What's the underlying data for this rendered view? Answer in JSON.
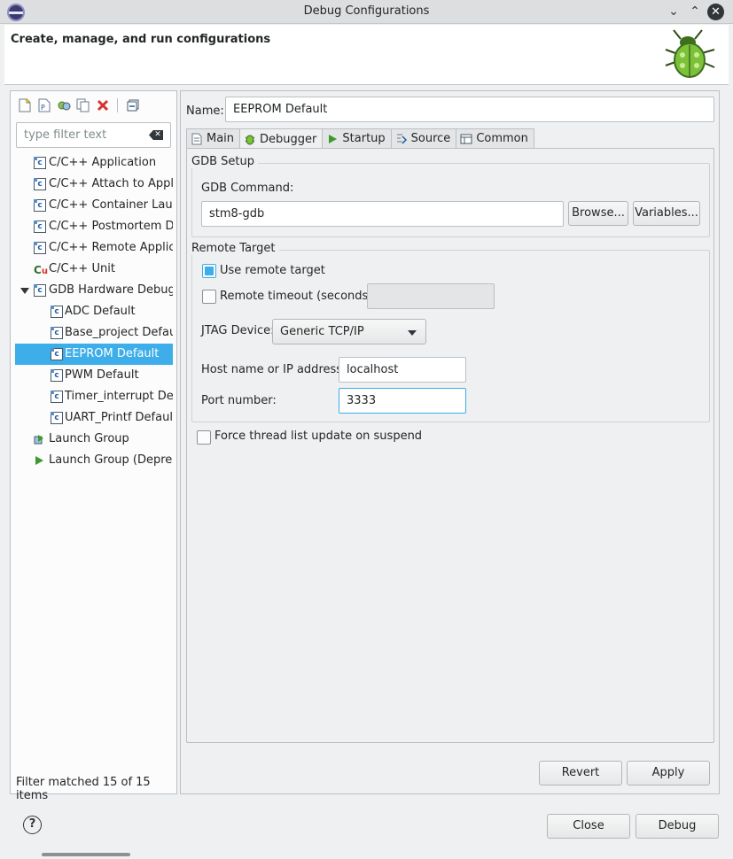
{
  "window": {
    "title": "Debug Configurations"
  },
  "header": {
    "heading": "Create, manage, and run configurations"
  },
  "left": {
    "filter_placeholder": "type filter text",
    "items": [
      {
        "label": "C/C++ Application"
      },
      {
        "label": "C/C++ Attach to Application"
      },
      {
        "label": "C/C++ Container Launcher"
      },
      {
        "label": "C/C++ Postmortem Debugger"
      },
      {
        "label": "C/C++ Remote Application"
      },
      {
        "label": "C/C++ Unit"
      },
      {
        "label": "GDB Hardware Debugging"
      },
      {
        "label": "ADC Default"
      },
      {
        "label": "Base_project Default"
      },
      {
        "label": "EEPROM Default"
      },
      {
        "label": "PWM Default"
      },
      {
        "label": "Timer_interrupt Default"
      },
      {
        "label": "UART_Printf Default"
      },
      {
        "label": "Launch Group"
      },
      {
        "label": "Launch Group (Deprecated)"
      }
    ],
    "filter_status": "Filter matched 15 of 15 items"
  },
  "right": {
    "name_label": "Name:",
    "name_value": "EEPROM Default",
    "tabs": [
      {
        "label": "Main"
      },
      {
        "label": "Debugger"
      },
      {
        "label": "Startup"
      },
      {
        "label": "Source"
      },
      {
        "label": "Common"
      }
    ],
    "gdb_setup": {
      "title": "GDB Setup",
      "command_label": "GDB Command:",
      "command_value": "stm8-gdb",
      "browse_label": "Browse...",
      "variables_label": "Variables..."
    },
    "remote_target": {
      "title": "Remote Target",
      "use_remote_label": "Use remote target",
      "timeout_label": "Remote timeout (seconds):",
      "jtag_label": "JTAG Device:",
      "jtag_value": "Generic TCP/IP",
      "host_label": "Host name or IP address:",
      "host_value": "localhost",
      "port_label": "Port number:",
      "port_value": "3333"
    },
    "force_thread_label": "Force thread list update on suspend",
    "revert_label": "Revert",
    "apply_label": "Apply"
  },
  "footer": {
    "close_label": "Close",
    "debug_label": "Debug"
  }
}
